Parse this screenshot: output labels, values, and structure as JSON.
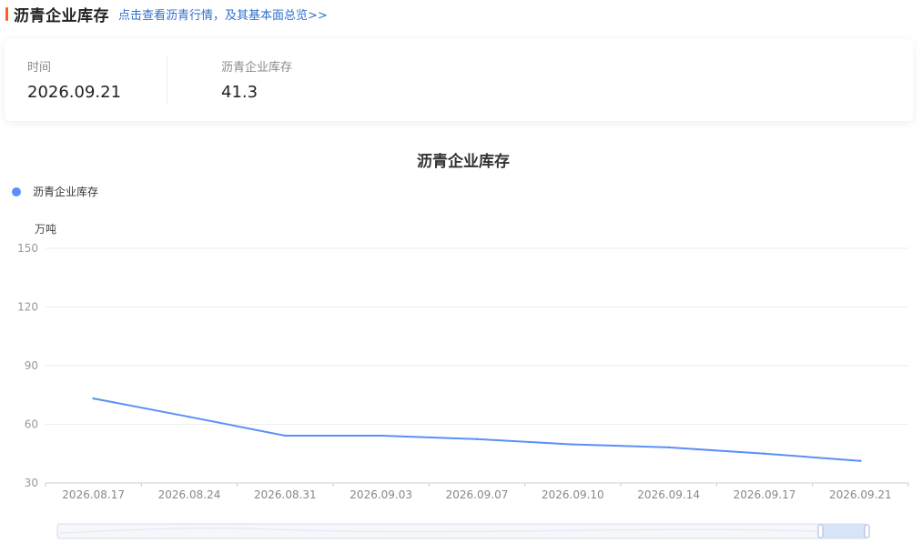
{
  "header": {
    "title": "沥青企业库存",
    "link_text": "点击查看沥青行情，及其基本面总览>>"
  },
  "info": {
    "time_label": "时间",
    "time_value": "2026.09.21",
    "stock_label": "沥青企业库存",
    "stock_value": "41.3"
  },
  "colors": {
    "accent": "#f5641f",
    "link": "#2f6fd1",
    "series": "#5b8ff9"
  },
  "chart_data": {
    "type": "line",
    "title": "沥青企业库存",
    "ylabel": "万吨",
    "xlabel": "",
    "ylim": [
      30,
      150
    ],
    "yticks": [
      30,
      60,
      90,
      120,
      150
    ],
    "grid": true,
    "legend_position": "top-left",
    "x": [
      "2026.08.17",
      "2026.08.24",
      "2026.08.31",
      "2026.09.03",
      "2026.09.07",
      "2026.09.10",
      "2026.09.14",
      "2026.09.17",
      "2026.09.21"
    ],
    "series": [
      {
        "name": "沥青企业库存",
        "values": [
          73.2,
          63.8,
          54.2,
          54.2,
          52.4,
          49.7,
          48.2,
          45.0,
          41.3
        ]
      }
    ]
  }
}
